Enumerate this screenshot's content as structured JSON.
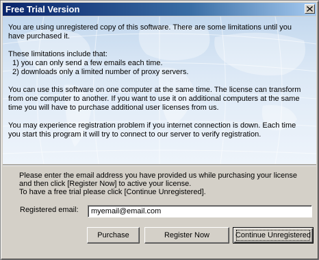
{
  "window": {
    "title": "Free Trial Version"
  },
  "icons": {
    "close": "close-icon"
  },
  "info": {
    "p1": "You are using unregistered copy of this software. There are some limitations until you have purchased it.",
    "limits_heading": "These limitations include that:",
    "limit1": "1) you can only send a few emails each time.",
    "limit2": "2) downloads only a limited number of proxy servers.",
    "p3": "You can use this software on one computer at the same time. The license can transform from one computer to another. If you want to use it on additional computers at the same time you will have to purchase additional user licenses from us.",
    "p4": "You may experience registration problem if you internet connection is down. Each time you start this program it will try to connect to our server to verify registration."
  },
  "registration": {
    "line1": "Please enter the email address you have provided us while purchasing your license",
    "line2": "and then click [Register Now] to active your license.",
    "line3": "To have a free trial please click [Continue Unregistered].",
    "email_label": "Registered email:",
    "email_value": "myemail@email.com"
  },
  "buttons": {
    "purchase": "Purchase",
    "register": "Register Now",
    "continue": "Continue Unregistered"
  },
  "colors": {
    "title_gradient_start": "#0a246a",
    "title_gradient_end": "#a6caf0",
    "dialog_face": "#d4d0c8",
    "panel_bg": "#dde9f6"
  }
}
